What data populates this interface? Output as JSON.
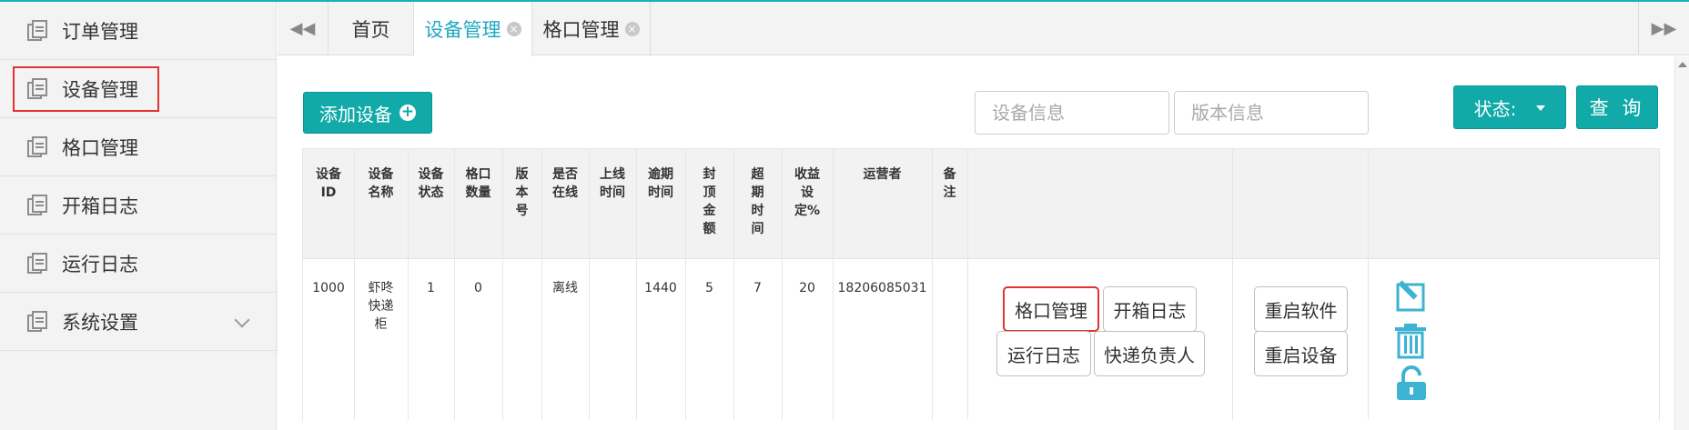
{
  "sidebar": {
    "items": [
      {
        "label": "订单管理"
      },
      {
        "label": "设备管理"
      },
      {
        "label": "格口管理"
      },
      {
        "label": "开箱日志"
      },
      {
        "label": "运行日志"
      },
      {
        "label": "系统设置"
      }
    ]
  },
  "tabs": [
    {
      "label": "首页"
    },
    {
      "label": "设备管理"
    },
    {
      "label": "格口管理"
    }
  ],
  "toolbar": {
    "add_label": "添加设备",
    "device_info_placeholder": "设备信息",
    "version_info_placeholder": "版本信息",
    "status_label": "状态:",
    "query_label": "查 询"
  },
  "table": {
    "headers": [
      [
        "设备",
        "ID"
      ],
      [
        "设备",
        "名称"
      ],
      [
        "设备",
        "状态"
      ],
      [
        "格口",
        "数量"
      ],
      [
        "版",
        "本",
        "号"
      ],
      [
        "是否",
        "在线"
      ],
      [
        "上线",
        "时间"
      ],
      [
        "逾期",
        "时间"
      ],
      [
        "封",
        "顶",
        "金",
        "额"
      ],
      [
        "超",
        "期",
        "时",
        "间"
      ],
      [
        "收益",
        "设",
        "定%"
      ],
      [
        "运营者"
      ],
      [
        "备",
        "注"
      ]
    ],
    "row": {
      "id": "1000",
      "name": [
        "虾咚",
        "快递",
        "柜"
      ],
      "status": "1",
      "slots": "0",
      "version": "",
      "online": "离线",
      "online_time": "",
      "overdue_time": "1440",
      "cap_amount": "5",
      "overdue_period": "7",
      "profit_pct": "20",
      "operator": "18206085031",
      "remark": ""
    },
    "actions": {
      "slot_manage": "格口管理",
      "open_log": "开箱日志",
      "run_log": "运行日志",
      "courier": "快递负责人",
      "restart_software": "重启软件",
      "restart_device": "重启设备"
    }
  },
  "colors": {
    "accent": "#12a9a9",
    "tab_active": "#1fa8c0",
    "highlight": "#e23232",
    "icon": "#3cb3d2"
  },
  "icons": [
    "page-icon",
    "chevron-down-icon",
    "double-left-arrow-icon",
    "double-right-arrow-icon",
    "close-circle-icon",
    "plus-circle-icon",
    "edit-icon",
    "trash-icon",
    "unlock-icon"
  ]
}
